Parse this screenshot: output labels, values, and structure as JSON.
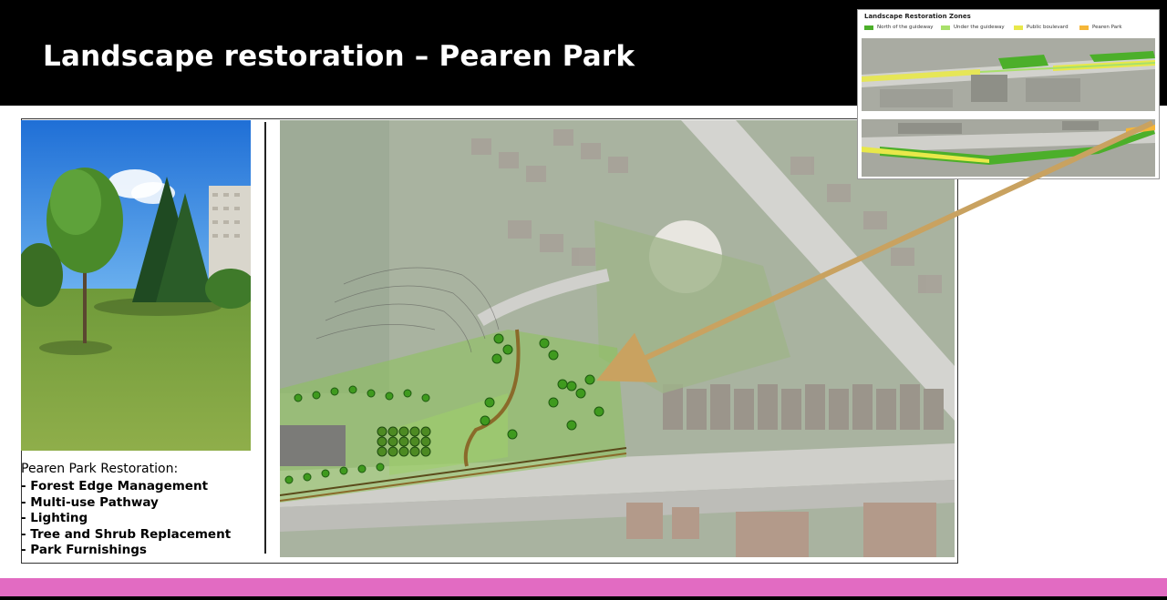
{
  "slide": {
    "title": "Landscape restoration – Pearen Park"
  },
  "restoration": {
    "heading": "Pearen Park Restoration:",
    "items": [
      "- Forest Edge Management",
      "- Multi-use Pathway",
      "- Lighting",
      "- Tree and Shrub Replacement",
      "- Park Furnishings"
    ]
  },
  "inset": {
    "title": "Landscape Restoration Zones",
    "legend": [
      {
        "label": "North of the guideway",
        "color": "#4caf2a"
      },
      {
        "label": "Under the guideway",
        "color": "#a8e06a"
      },
      {
        "label": "Public boulevard",
        "color": "#e8e84a"
      },
      {
        "label": "Pearen Park",
        "color": "#f5b638"
      }
    ]
  },
  "colors": {
    "title_bar": "#000000",
    "title_text": "#ffffff",
    "accent_bar": "#e26bc2",
    "arrow": "#c9a260"
  }
}
